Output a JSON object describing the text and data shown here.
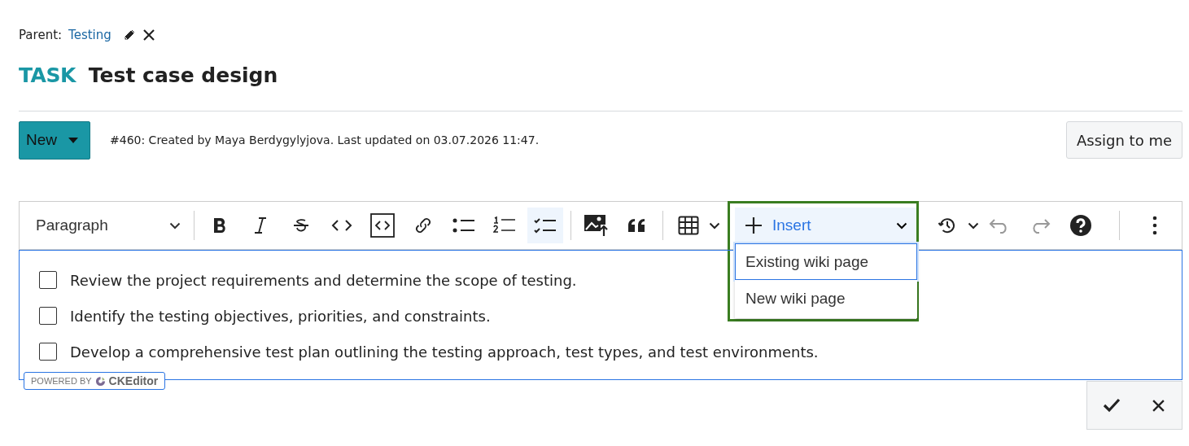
{
  "parent": {
    "label": "Parent:",
    "link": "Testing"
  },
  "heading": {
    "type": "TASK",
    "title": "Test case design"
  },
  "status": {
    "label": "New"
  },
  "meta": "#460: Created by Maya Berdygylyjova. Last updated on 03.07.2026 11:47.",
  "assign_button": "Assign to me",
  "toolbar": {
    "heading": "Paragraph",
    "buttons": [
      {
        "kind": "bold",
        "on": false,
        "disabled": false
      },
      {
        "kind": "italic",
        "on": false,
        "disabled": false
      },
      {
        "kind": "strike",
        "on": false,
        "disabled": false
      },
      {
        "kind": "code",
        "on": false,
        "disabled": false
      },
      {
        "kind": "codeblock",
        "on": false,
        "disabled": false
      },
      {
        "kind": "link",
        "on": false,
        "disabled": false
      },
      {
        "kind": "bullets",
        "on": false,
        "disabled": false
      },
      {
        "kind": "numbers",
        "on": false,
        "disabled": false
      },
      {
        "kind": "todo",
        "on": true,
        "disabled": false
      },
      {
        "kind": "image",
        "on": false,
        "disabled": false
      },
      {
        "kind": "quote",
        "on": false,
        "disabled": false
      },
      {
        "kind": "table",
        "on": false,
        "disabled": false
      }
    ],
    "insert": {
      "label": "Insert",
      "expanded": true,
      "highlighted": true,
      "items": [
        {
          "label": "Existing wiki page",
          "selected": true
        },
        {
          "label": "New wiki page",
          "selected": false
        }
      ]
    },
    "tail_buttons": [
      {
        "kind": "history",
        "disabled": false
      },
      {
        "kind": "undo",
        "disabled": true
      },
      {
        "kind": "redo",
        "disabled": true
      },
      {
        "kind": "help",
        "disabled": false
      },
      {
        "kind": "more",
        "disabled": false
      }
    ]
  },
  "checklist": [
    {
      "text": "Review the project requirements and determine the scope of testing.",
      "checked": false
    },
    {
      "text": "Identify the testing objectives, priorities, and constraints.",
      "checked": false
    },
    {
      "text": "Develop a comprehensive test plan outlining the testing approach, test types, and test environments.",
      "checked": false
    }
  ],
  "powered_by": {
    "label": "POWERED BY",
    "brand": "CKEditor"
  }
}
